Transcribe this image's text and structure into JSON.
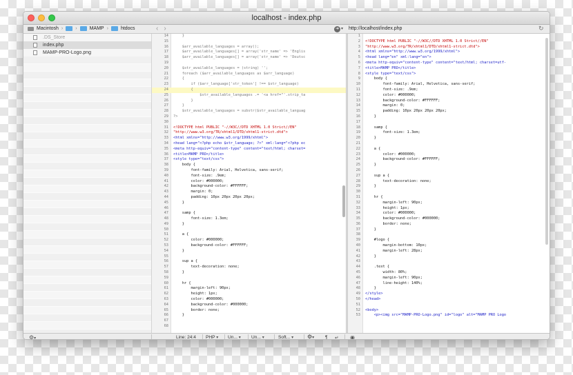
{
  "window": {
    "title": "localhost - index.php"
  },
  "breadcrumb": [
    "Macintosh",
    "MAMP",
    "htdocs"
  ],
  "url": "http://localhost/index.php",
  "files": [
    {
      "name": ".DS_Store",
      "dim": true,
      "selected": false
    },
    {
      "name": "index.php",
      "dim": false,
      "selected": true
    },
    {
      "name": "MAMP-PRO-Logo.png",
      "dim": false,
      "selected": false
    }
  ],
  "editor_lines": [
    {
      "n": "14",
      "t": "    }",
      "c": "php"
    },
    {
      "n": "15",
      "t": "",
      "c": "php"
    },
    {
      "n": "16",
      "t": "    $arr_available_languages = array();",
      "c": "php"
    },
    {
      "n": "17",
      "t": "    $arr_available_languages[] = array('str_name' => 'Englis",
      "c": "php"
    },
    {
      "n": "18",
      "t": "    $arr_available_languages[] = array('str_name' => 'Deutsc",
      "c": "php"
    },
    {
      "n": "19",
      "t": "",
      "c": "php"
    },
    {
      "n": "20",
      "t": "    $str_available_languages = (string) '';",
      "c": "php"
    },
    {
      "n": "21",
      "t": "    foreach ($arr_available_languages as $arr_language)",
      "c": "php"
    },
    {
      "n": "22",
      "t": "    {",
      "c": "php"
    },
    {
      "n": "23",
      "t": "        if ($arr_language['str_token'] !== $str_language)",
      "c": "php"
    },
    {
      "n": "24",
      "t": "        {",
      "c": "php hl"
    },
    {
      "n": "25",
      "t": "            $str_available_languages .= '<a href=\"'.strip_ta",
      "c": "php"
    },
    {
      "n": "26",
      "t": "        }",
      "c": "php"
    },
    {
      "n": "27",
      "t": "    }",
      "c": "php"
    },
    {
      "n": "28",
      "t": "    $str_available_languages = substr($str_available_languag",
      "c": "php"
    },
    {
      "n": "29",
      "t": "?>",
      "c": "php"
    },
    {
      "n": "30",
      "t": "",
      "c": ""
    },
    {
      "n": "31",
      "t": "<!DOCTYPE html PUBLIC \"-//W3C//DTD XHTML 1.0 Strict//EN\"",
      "c": "dt"
    },
    {
      "n": "32",
      "t": "\"http://www.w3.org/TR/xhtml1/DTD/xhtml1-strict.dtd\">",
      "c": "dt"
    },
    {
      "n": "33",
      "t": "<html xmlns=\"http://www.w3.org/1999/xhtml\">",
      "c": "tag"
    },
    {
      "n": "34",
      "t": "<head lang=\"<?php echo $str_language; ?>\" xml:lang=\"<?php ec",
      "c": "tag"
    },
    {
      "n": "35",
      "t": "<meta http-equiv=\"content-type\" content=\"text/html; charset=",
      "c": "tag"
    },
    {
      "n": "36",
      "t": "<title>MAMP PRO</title>",
      "c": "tag"
    },
    {
      "n": "37",
      "t": "<style type=\"text/css\">",
      "c": "tag"
    },
    {
      "n": "38",
      "t": "    body {",
      "c": ""
    },
    {
      "n": "39",
      "t": "        font-family: Arial, Helvetica, sans-serif;",
      "c": ""
    },
    {
      "n": "40",
      "t": "        font-size: .9em;",
      "c": ""
    },
    {
      "n": "41",
      "t": "        color: #000000;",
      "c": ""
    },
    {
      "n": "42",
      "t": "        background-color: #FFFFFF;",
      "c": ""
    },
    {
      "n": "43",
      "t": "        margin: 0;",
      "c": ""
    },
    {
      "n": "44",
      "t": "        padding: 10px 20px 20px 20px;",
      "c": ""
    },
    {
      "n": "45",
      "t": "    }",
      "c": ""
    },
    {
      "n": "46",
      "t": "",
      "c": ""
    },
    {
      "n": "47",
      "t": "    samp {",
      "c": ""
    },
    {
      "n": "48",
      "t": "        font-size: 1.3em;",
      "c": ""
    },
    {
      "n": "49",
      "t": "    }",
      "c": ""
    },
    {
      "n": "50",
      "t": "",
      "c": ""
    },
    {
      "n": "51",
      "t": "    a {",
      "c": ""
    },
    {
      "n": "52",
      "t": "        color: #000000;",
      "c": ""
    },
    {
      "n": "53",
      "t": "        background-color: #FFFFFF;",
      "c": ""
    },
    {
      "n": "54",
      "t": "    }",
      "c": ""
    },
    {
      "n": "55",
      "t": "",
      "c": ""
    },
    {
      "n": "56",
      "t": "    sup a {",
      "c": ""
    },
    {
      "n": "57",
      "t": "        text-decoration: none;",
      "c": ""
    },
    {
      "n": "58",
      "t": "    }",
      "c": ""
    },
    {
      "n": "59",
      "t": "",
      "c": ""
    },
    {
      "n": "60",
      "t": "    hr {",
      "c": ""
    },
    {
      "n": "61",
      "t": "        margin-left: 90px;",
      "c": ""
    },
    {
      "n": "62",
      "t": "        height: 1px;",
      "c": ""
    },
    {
      "n": "63",
      "t": "        color: #000000;",
      "c": ""
    },
    {
      "n": "64",
      "t": "        background-color: #000000;",
      "c": ""
    },
    {
      "n": "65",
      "t": "        border: none;",
      "c": ""
    },
    {
      "n": "66",
      "t": "    }",
      "c": ""
    },
    {
      "n": "67",
      "t": "",
      "c": ""
    },
    {
      "n": "68",
      "t": "",
      "c": ""
    }
  ],
  "preview_lines": [
    {
      "n": "1",
      "t": "",
      "c": ""
    },
    {
      "n": "2",
      "t": "<!DOCTYPE html PUBLIC \"-//W3C//DTD XHTML 1.0 Strict//EN\"",
      "c": "dt"
    },
    {
      "n": "3",
      "t": "\"http://www.w3.org/TR/xhtml1/DTD/xhtml1-strict.dtd\">",
      "c": "dt"
    },
    {
      "n": "4",
      "t": "<html xmlns=\"http://www.w3.org/1999/xhtml\">",
      "c": "tag"
    },
    {
      "n": "5",
      "t": "<head lang=\"en\" xml:lang=\"en\">",
      "c": "tag"
    },
    {
      "n": "6",
      "t": "<meta http-equiv=\"content-type\" content=\"text/html; charset=utf-",
      "c": "tag"
    },
    {
      "n": "7",
      "t": "<title>MAMP PRO</title>",
      "c": "tag"
    },
    {
      "n": "8",
      "t": "<style type=\"text/css\">",
      "c": "tag"
    },
    {
      "n": "9",
      "t": "    body {",
      "c": ""
    },
    {
      "n": "10",
      "t": "        font-family: Arial, Helvetica, sans-serif;",
      "c": ""
    },
    {
      "n": "11",
      "t": "        font-size: .9em;",
      "c": ""
    },
    {
      "n": "12",
      "t": "        color: #000000;",
      "c": ""
    },
    {
      "n": "13",
      "t": "        background-color: #FFFFFF;",
      "c": ""
    },
    {
      "n": "14",
      "t": "        margin: 0;",
      "c": ""
    },
    {
      "n": "15",
      "t": "        padding: 10px 20px 20px 20px;",
      "c": ""
    },
    {
      "n": "16",
      "t": "    }",
      "c": ""
    },
    {
      "n": "17",
      "t": "",
      "c": ""
    },
    {
      "n": "18",
      "t": "    samp {",
      "c": ""
    },
    {
      "n": "19",
      "t": "        font-size: 1.3em;",
      "c": ""
    },
    {
      "n": "20",
      "t": "    }",
      "c": ""
    },
    {
      "n": "21",
      "t": "",
      "c": ""
    },
    {
      "n": "22",
      "t": "    a {",
      "c": ""
    },
    {
      "n": "23",
      "t": "        color: #000000;",
      "c": ""
    },
    {
      "n": "24",
      "t": "        background-color: #FFFFFF;",
      "c": ""
    },
    {
      "n": "25",
      "t": "    }",
      "c": ""
    },
    {
      "n": "26",
      "t": "",
      "c": ""
    },
    {
      "n": "27",
      "t": "    sup a {",
      "c": ""
    },
    {
      "n": "28",
      "t": "        text-decoration: none;",
      "c": ""
    },
    {
      "n": "29",
      "t": "    }",
      "c": ""
    },
    {
      "n": "30",
      "t": "",
      "c": ""
    },
    {
      "n": "31",
      "t": "    hr {",
      "c": ""
    },
    {
      "n": "32",
      "t": "        margin-left: 90px;",
      "c": ""
    },
    {
      "n": "33",
      "t": "        height: 1px;",
      "c": ""
    },
    {
      "n": "34",
      "t": "        color: #000000;",
      "c": ""
    },
    {
      "n": "35",
      "t": "        background-color: #000000;",
      "c": ""
    },
    {
      "n": "36",
      "t": "        border: none;",
      "c": ""
    },
    {
      "n": "37",
      "t": "    }",
      "c": ""
    },
    {
      "n": "38",
      "t": "",
      "c": ""
    },
    {
      "n": "39",
      "t": "    #logo {",
      "c": ""
    },
    {
      "n": "40",
      "t": "        margin-bottom: 10px;",
      "c": ""
    },
    {
      "n": "41",
      "t": "        margin-left: 28px;",
      "c": ""
    },
    {
      "n": "42",
      "t": "    }",
      "c": ""
    },
    {
      "n": "43",
      "t": "",
      "c": ""
    },
    {
      "n": "44",
      "t": "    .text {",
      "c": ""
    },
    {
      "n": "45",
      "t": "        width: 80%;",
      "c": ""
    },
    {
      "n": "46",
      "t": "        margin-left: 90px;",
      "c": ""
    },
    {
      "n": "47",
      "t": "        line-height: 140%;",
      "c": ""
    },
    {
      "n": "48",
      "t": "    }",
      "c": ""
    },
    {
      "n": "49",
      "t": "</style>",
      "c": "tag"
    },
    {
      "n": "50",
      "t": "</head>",
      "c": "tag"
    },
    {
      "n": "51",
      "t": "",
      "c": ""
    },
    {
      "n": "52",
      "t": "<body>",
      "c": "tag"
    },
    {
      "n": "53",
      "t": "    <p><img src=\"MAMP-PRO-Logo.png\" id=\"logo\" alt=\"MAMP PRO Logo",
      "c": "tag"
    }
  ],
  "status": {
    "line": "Line: 24:4",
    "syntax": "PHP",
    "encoding": "Un...",
    "line_endings": "Un...",
    "soft_wrap": "Soft...",
    "pilcrow": "¶",
    "return": "↵"
  },
  "icons": {
    "gear": "gear-icon",
    "eye": "eye-icon",
    "refresh": "refresh-icon",
    "go": "go-arrow-icon"
  }
}
